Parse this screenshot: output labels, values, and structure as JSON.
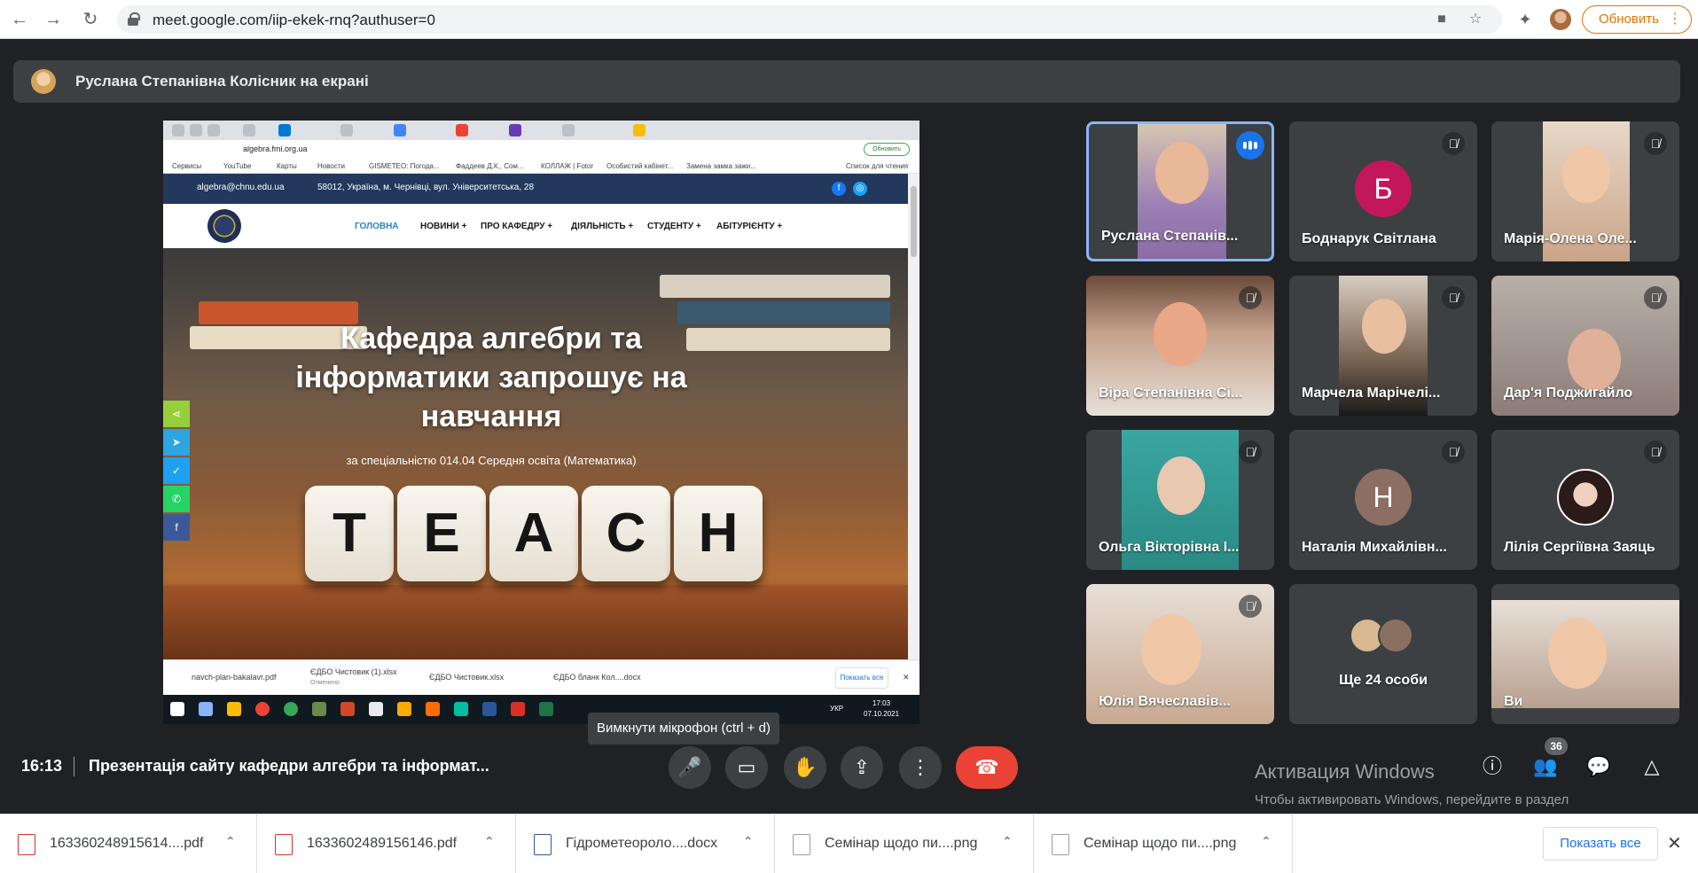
{
  "browser": {
    "url": "meet.google.com/iip-ekek-rnq?authuser=0",
    "update_label": "Обновить",
    "update_dots": "⋮"
  },
  "presenter": {
    "text": "Руслана Степанівна Колісник на екрані"
  },
  "shared_screen": {
    "mini_url": "algebra.fmi.org.ua",
    "mini_update": "Обновить",
    "bookmarks": [
      "Сервисы",
      "YouTube",
      "Карты",
      "Новости",
      "GISMETEO: Погода...",
      "Фаддеев Д.К., Сом...",
      "КОЛЛАЖ | Fotor",
      "Особистий кабінет...",
      "Замена замка зажи...",
      "Список для чтения"
    ],
    "site_email": "algebra@chnu.edu.ua",
    "site_address": "58012, Україна, м. Чернівці, вул. Університетська, 28",
    "nav": [
      "ГОЛОВНА",
      "НОВИНИ +",
      "ПРО КАФЕДРУ +",
      "ДІЯЛЬНІСТЬ +",
      "СТУДЕНТУ +",
      "АБІТУРІЄНТУ +"
    ],
    "hero_title": "Кафедра алгебри та інформатики запрошує на навчання",
    "hero_subtitle": "за спеціальністю 014.04 Середня освіта (Математика)",
    "dice": [
      "T",
      "E",
      "A",
      "C",
      "H"
    ],
    "mini_downloads": [
      "navch-plan-bakalavr.pdf",
      "ЄДБО Чистовик (1).xlsx",
      "ЄДБО Чистовик.xlsx",
      "ЄДБО бланк Кол....docx"
    ],
    "mini_downloads_sub": "Отменено",
    "mini_showall": "Показать все",
    "clock_time": "17:03",
    "clock_date": "07.10.2021",
    "lang": "УКР"
  },
  "participants": [
    {
      "name": "Руслана Степанів...",
      "speaking": true,
      "type": "video",
      "bg": "#8a6aa0"
    },
    {
      "name": "Боднарук Світлана",
      "type": "letter",
      "letter": "Б",
      "color": "#c2185b"
    },
    {
      "name": "Марія-Олена Оле...",
      "type": "video",
      "bg": "#c9a488"
    },
    {
      "name": "Віра Степанівна Сі...",
      "type": "video",
      "bg": "#c4a08a"
    },
    {
      "name": "Марчела Марічелі...",
      "type": "video",
      "bg": "#7a6454"
    },
    {
      "name": "Дар'я Поджигайло",
      "type": "video",
      "bg": "#8c7c78"
    },
    {
      "name": "Ольга Вікторівна І...",
      "type": "video",
      "bg": "#3aa6a0"
    },
    {
      "name": "Наталія Михайлівн...",
      "type": "letter",
      "letter": "Н",
      "color": "#8d6e63"
    },
    {
      "name": "Лілія Сергіївна Заяць",
      "type": "photo"
    },
    {
      "name": "Юлія Вячеславів...",
      "type": "video",
      "bg": "#c8a890"
    },
    {
      "name": "Ще 24 особи",
      "type": "more"
    },
    {
      "name": "Ви",
      "type": "self",
      "bg": "#b8a090"
    }
  ],
  "tooltip": "Вимкнути мікрофон (ctrl + d)",
  "meeting": {
    "time": "16:13",
    "title": "Презентація сайту кафедри алгебри та інформат...",
    "people_count": "36"
  },
  "activation": {
    "title": "Активация Windows",
    "subtitle": "Чтобы активировать Windows, перейдите в раздел \"Параметры\"."
  },
  "downloads": [
    {
      "name": "163360248915614....pdf",
      "type": "pdf"
    },
    {
      "name": "1633602489156146.pdf",
      "type": "pdf"
    },
    {
      "name": "Гідрометеороло....docx",
      "type": "docx"
    },
    {
      "name": "Семінар щодо пи....png",
      "type": "png"
    },
    {
      "name": "Семінар щодо пи....png",
      "type": "png"
    }
  ],
  "downloads_showall": "Показать все",
  "colors": {
    "meet_bg": "#202124",
    "tile_bg": "#3c4043",
    "end_call": "#ea4335",
    "accent_blue": "#1a73e8",
    "update_orange": "#e37400"
  }
}
